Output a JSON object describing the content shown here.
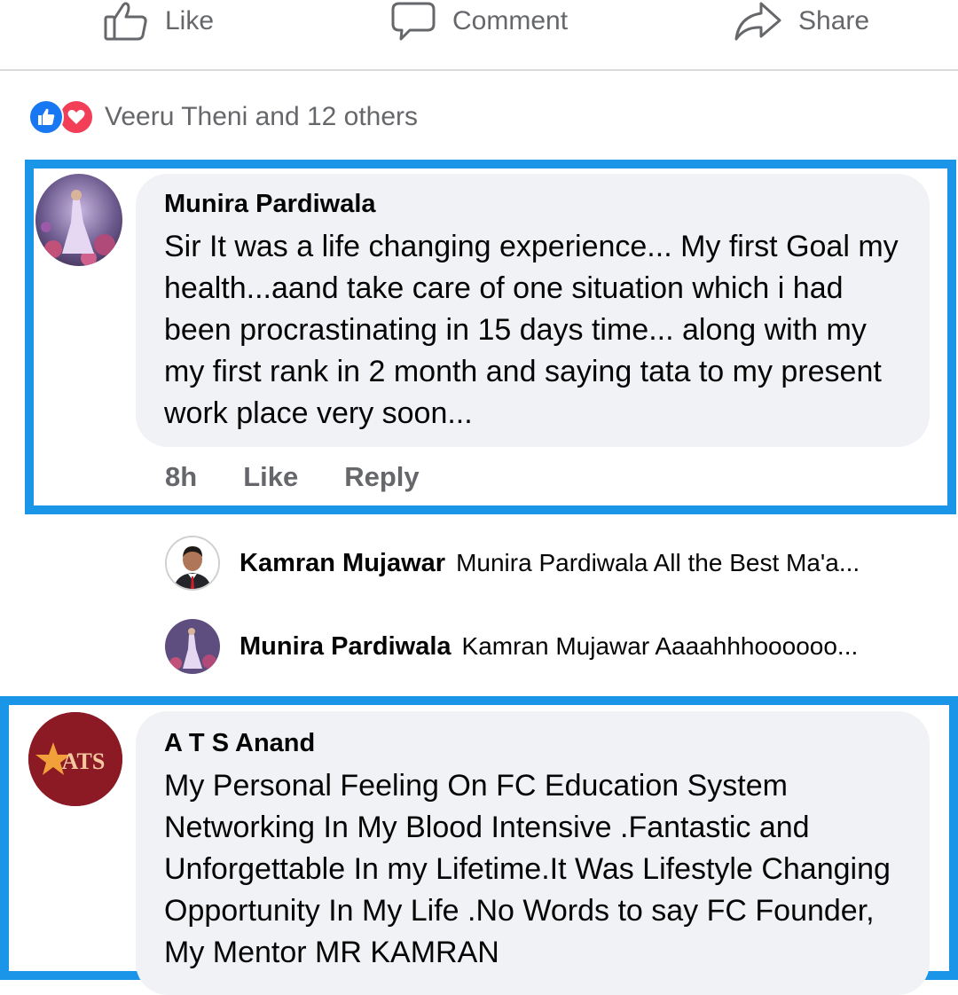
{
  "actions": {
    "like": "Like",
    "comment": "Comment",
    "share": "Share"
  },
  "reactions": {
    "icons": [
      "like-icon",
      "love-icon"
    ],
    "summary": "Veeru Theni and 12 others"
  },
  "comments": [
    {
      "author": "Munira Pardiwala",
      "text": "Sir It was a life changing experience... My first Goal my health...aand take care of one situation which i had been procrastinating in 15 days time... along with my my first rank in 2 month and saying tata to my present work place very soon...",
      "time": "8h",
      "like_label": "Like",
      "reply_label": "Reply"
    },
    {
      "author": "A T S Anand",
      "avatar_text": "ATS",
      "text": "My Personal Feeling On FC Education System Networking In My Blood Intensive .Fantastic and Unforgettable In my Lifetime.It Was Lifestyle Changing Opportunity In My Life .No Words to say FC Founder, My Mentor MR KAMRAN"
    }
  ],
  "replies": [
    {
      "author": "Kamran Mujawar",
      "text": "Munira Pardiwala All the Best Ma'a..."
    },
    {
      "author": "Munira Pardiwala",
      "text": "Kamran Mujawar Aaaahhhoooooo..."
    }
  ],
  "colors": {
    "highlight": "#1b95e8",
    "bubble": "#f0f2f5",
    "secondary_text": "#65676b",
    "like_blue": "#1877f2",
    "love_red": "#f33e58"
  }
}
